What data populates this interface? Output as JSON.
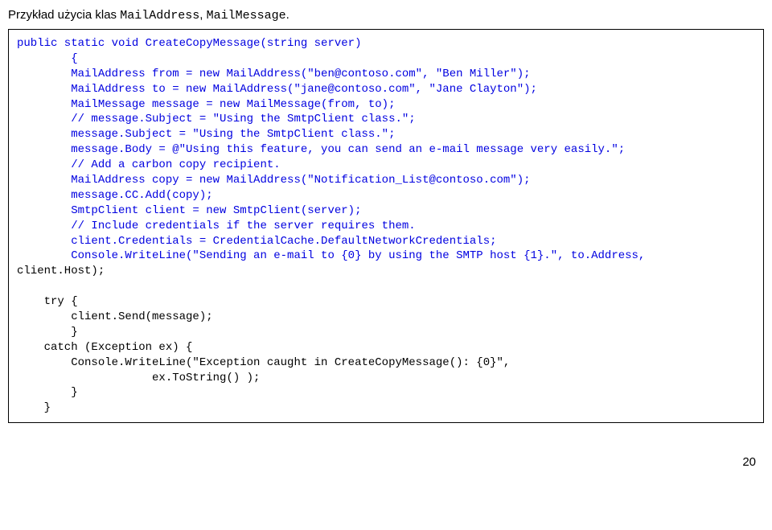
{
  "heading": {
    "prefix": "Przykład użycia klas ",
    "class1": "MailAddress",
    "sep": ", ",
    "class2": "MailMessage",
    "suffix": "."
  },
  "code": {
    "l01": "public static void CreateCopyMessage(string server)",
    "l02": "        {",
    "l03": "        MailAddress from = new MailAddress(\"ben@contoso.com\", \"Ben Miller\");",
    "l04": "        MailAddress to = new MailAddress(\"jane@contoso.com\", \"Jane Clayton\");",
    "l05": "        MailMessage message = new MailMessage(from, to);",
    "l06": "        // message.Subject = \"Using the SmtpClient class.\";",
    "l07": "        message.Subject = \"Using the SmtpClient class.\";",
    "l08": "        message.Body = @\"Using this feature, you can send an e-mail message very easily.\";",
    "l09": "        // Add a carbon copy recipient.",
    "l10": "        MailAddress copy = new MailAddress(\"Notification_List@contoso.com\");",
    "l11": "        message.CC.Add(copy);",
    "l12": "        SmtpClient client = new SmtpClient(server);",
    "l13": "        // Include credentials if the server requires them.",
    "l14": "        client.Credentials = CredentialCache.DefaultNetworkCredentials;",
    "l15": "        Console.WriteLine(\"Sending an e-mail to {0} by using the SMTP host {1}.\", to.Address,",
    "l16": "client.Host);",
    "l17": "",
    "l18": "    try {",
    "l19": "        client.Send(message);",
    "l20": "        }",
    "l21": "    catch (Exception ex) {",
    "l22": "        Console.WriteLine(\"Exception caught in CreateCopyMessage(): {0}\",",
    "l23": "                    ex.ToString() );",
    "l24": "        }",
    "l25": "    }"
  },
  "pageNumber": "20"
}
